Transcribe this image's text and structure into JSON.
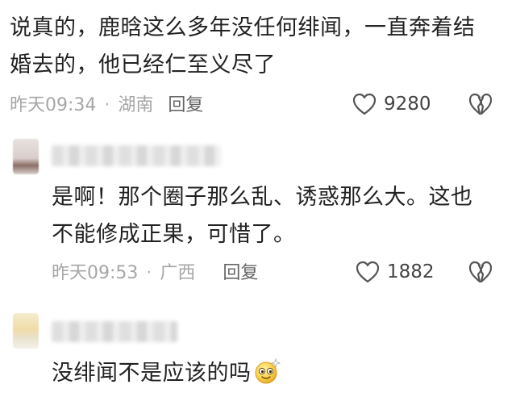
{
  "comment1": {
    "text_line1": "说真的，鹿晗这么多年没任何绯闻，一直奔着结",
    "text_line2": "婚去的，他已经仁至义尽了",
    "time": "昨天09:34",
    "separator": "·",
    "location": "湖南",
    "reply_label": "回复",
    "likes": "9280",
    "like_icon": "heart-outline-icon",
    "dislike_icon": "broken-heart-icon"
  },
  "reply1": {
    "text_line1": "是啊！那个圈子那么乱、诱惑那么大。这也",
    "text_line2": "不能修成正果，可惜了。",
    "time": "昨天09:53",
    "separator": "·",
    "location": "广西",
    "reply_label": "回复",
    "likes": "1882",
    "like_icon": "heart-outline-icon",
    "dislike_icon": "broken-heart-icon"
  },
  "reply2": {
    "text": "没绯闻不是应该的吗",
    "emoji_icon": "smiley-face-sparkle-icon"
  },
  "colors": {
    "text": "#222222",
    "meta": "#a6a6a6",
    "reply_link": "#666666",
    "icon": "#555555"
  }
}
